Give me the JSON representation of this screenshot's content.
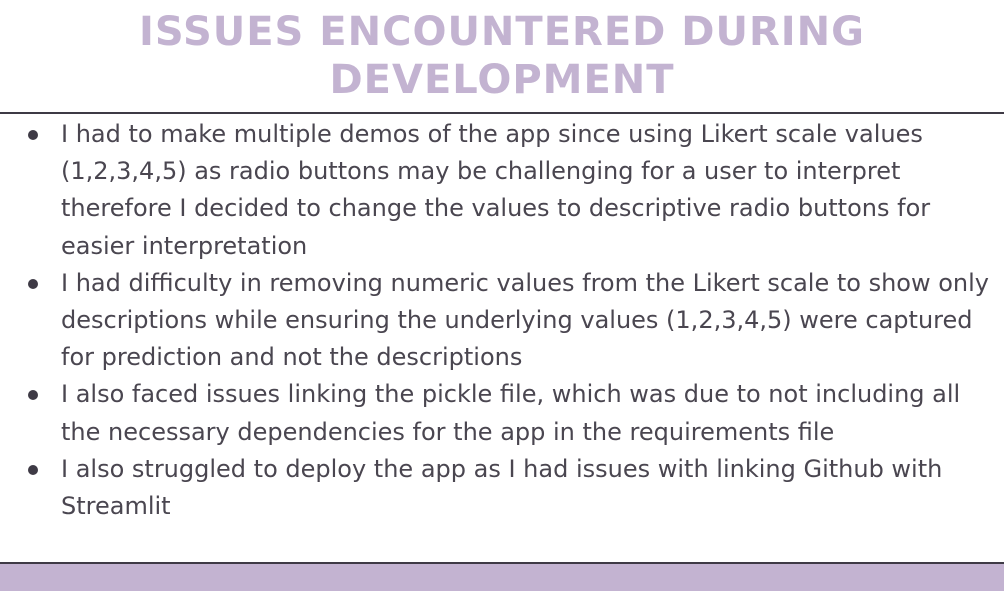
{
  "slide": {
    "title": "ISSUES ENCOUNTERED DURING DEVELOPMENT",
    "bullets": [
      "I had to make multiple demos of the app since using Likert scale values (1,2,3,4,5) as radio buttons may be challenging for a user to interpret therefore I decided to change the values to descriptive radio buttons for easier interpretation",
      "I had difficulty in removing numeric values from the Likert scale to show only descriptions while ensuring the underlying values (1,2,3,4,5) were captured for prediction and not the descriptions",
      "I also faced issues linking the pickle file, which was due to not including all the necessary dependencies for the app in the requirements file",
      "I also struggled to deploy the app as I had issues with linking Github with Streamlit"
    ]
  },
  "colors": {
    "title": "#c3b3d1",
    "text": "#4a4650",
    "rule": "#3e3a45",
    "footer_band": "#c3b3d1",
    "background": "#ffffff"
  }
}
